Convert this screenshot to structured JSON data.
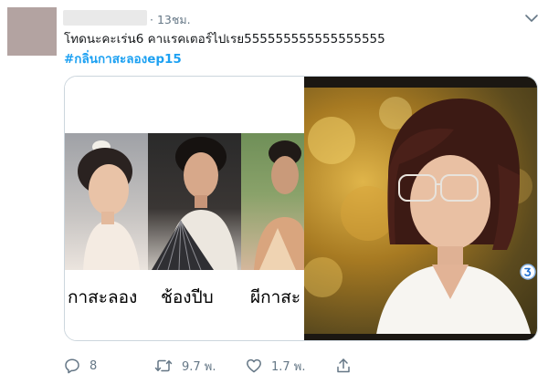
{
  "tweet": {
    "time": "· 13ชม.",
    "text": "โทดนะคะเร่น6 คาแรคเตอร์ไปเรย555555555555555555",
    "hashtag": "#กลิ่นกาสะลองep15",
    "media": {
      "captions": [
        "กาสะลอง",
        "ช้องปีบ",
        "ผีกาสะ"
      ],
      "channel_logo": "channel-3-logo"
    },
    "actions": {
      "reply_count": "8",
      "retweet_count": "9.7 พ.",
      "like_count": "1.7 พ."
    }
  },
  "icons": {
    "more": "chevron-down-icon",
    "reply": "reply-icon",
    "retweet": "retweet-icon",
    "like": "heart-icon",
    "share": "share-icon"
  },
  "colors": {
    "link": "#1da1f2",
    "secondary_text": "#657786",
    "border": "#ccd6dd"
  }
}
